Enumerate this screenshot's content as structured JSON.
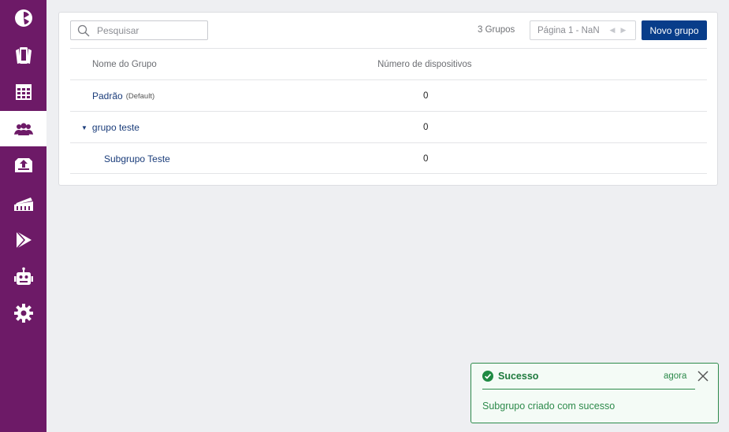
{
  "sidebar": {
    "items": [
      {
        "icon": "dashboard-icon"
      },
      {
        "icon": "devices-icon"
      },
      {
        "icon": "table-icon"
      },
      {
        "icon": "groups-icon",
        "active": true
      },
      {
        "icon": "upload-box-icon"
      },
      {
        "icon": "packages-icon"
      },
      {
        "icon": "play-store-icon"
      },
      {
        "icon": "robot-icon"
      },
      {
        "icon": "gear-icon"
      }
    ],
    "color": "#6d1a67"
  },
  "toolbar": {
    "search_placeholder": "Pesquisar",
    "group_count": "3 Grupos",
    "pagination": "Página 1 - NaN",
    "new_group_label": "Novo grupo"
  },
  "table": {
    "headers": {
      "name": "Nome do Grupo",
      "count": "Número de dispositivos"
    },
    "rows": [
      {
        "name": "Padrão",
        "tag": "(Default)",
        "count": "0",
        "level": 0,
        "expandable": false
      },
      {
        "name": "grupo teste",
        "tag": "",
        "count": "0",
        "level": 0,
        "expandable": true
      },
      {
        "name": "Subgrupo Teste",
        "tag": "",
        "count": "0",
        "level": 1,
        "expandable": false
      }
    ]
  },
  "toast": {
    "title": "Sucesso",
    "time": "agora",
    "message": "Subgrupo criado com sucesso"
  },
  "colors": {
    "accent": "#083d8a",
    "success": "#2c8a4a",
    "link": "#1a3c7a"
  }
}
